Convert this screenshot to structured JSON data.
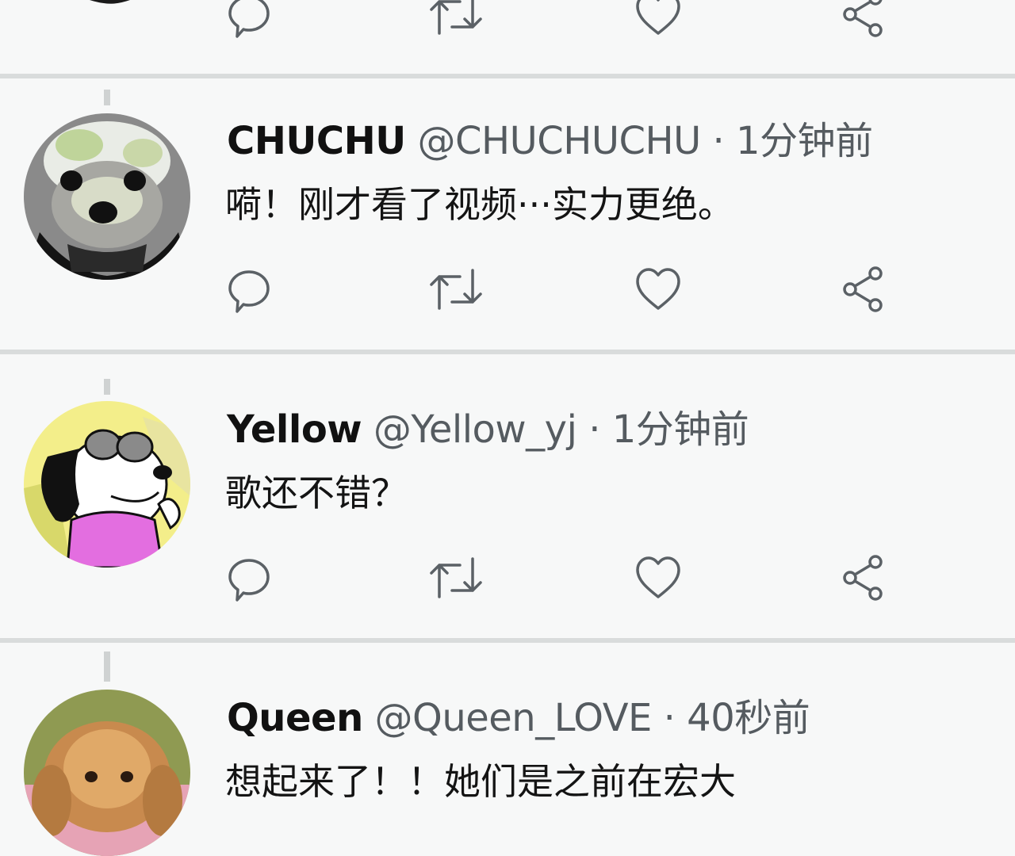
{
  "feed": {
    "tweets": [
      {
        "display_name": "CHUCHU",
        "handle": "@CHUCHUCHU",
        "separator": "·",
        "time": "1分钟前",
        "text": "嗬！刚才看了视频···实力更绝。",
        "avatar": "poodle-avatar-gray"
      },
      {
        "display_name": "Yellow",
        "handle": "@Yellow_yj",
        "separator": "·",
        "time": "1分钟前",
        "text": "歌还不错？",
        "avatar": "snoopy-avatar"
      },
      {
        "display_name": "Queen",
        "handle": "@Queen_LOVE",
        "separator": "·",
        "time": "40秒前",
        "text": "想起来了！！她们是之前在宏大",
        "avatar": "poodle-avatar-brown"
      }
    ],
    "action_icons": [
      "reply-icon",
      "retweet-icon",
      "like-icon",
      "share-icon"
    ]
  },
  "colors": {
    "background": "#f7f8f8",
    "divider": "#d9dcdc",
    "icon": "#5b6166",
    "muted_text": "#555b60"
  }
}
